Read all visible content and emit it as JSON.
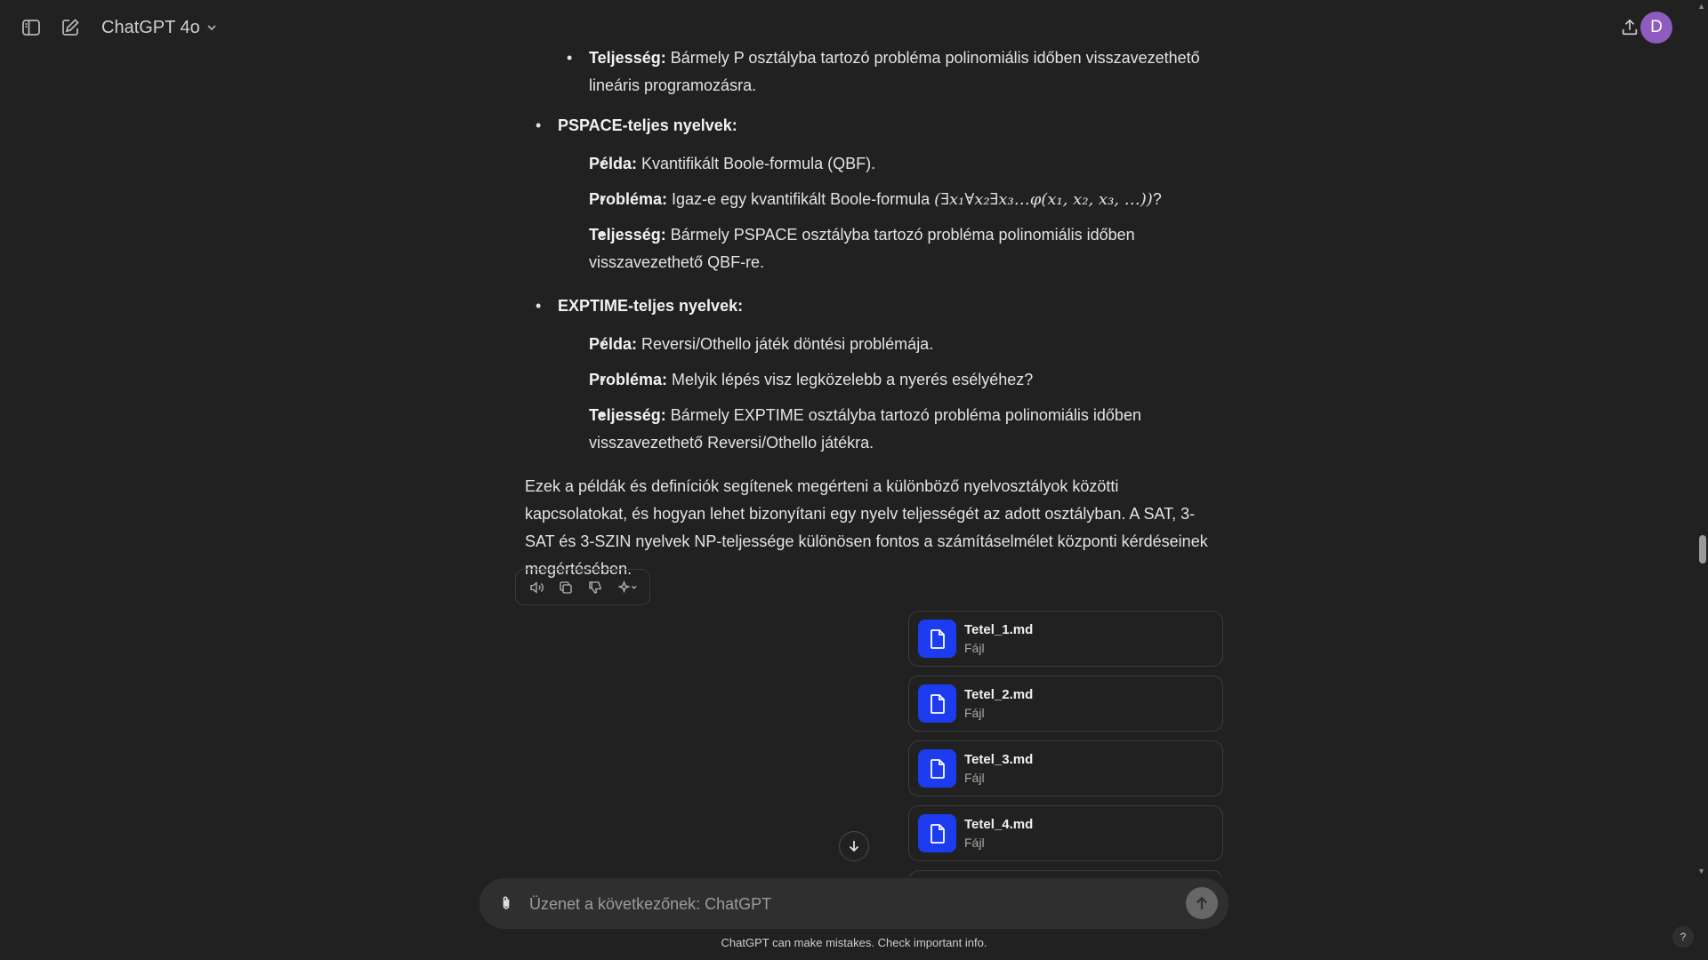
{
  "header": {
    "model_label": "ChatGPT 4o",
    "avatar_initial": "D",
    "icons": [
      "sidebar-toggle-icon",
      "new-chat-icon",
      "chevron-down-icon",
      "share-icon"
    ]
  },
  "message": {
    "top_item_bold": "Teljesség:",
    "top_item_text": " Bármely P osztályba tartozó probléma polinomiális időben visszavezethető lineáris programozásra.",
    "sections": [
      {
        "title": "PSPACE-teljes nyelvek:",
        "items": [
          {
            "bold": "Példa:",
            "text": " Kvantifikált Boole-formula (QBF)."
          },
          {
            "bold": "Probléma:",
            "text": " Igaz-e egy kvantifikált Boole-formula ",
            "math": "(∃x₁∀x₂∃x₃…φ(x₁, x₂, x₃, …))",
            "after": "?"
          },
          {
            "bold": "Teljesség:",
            "text": " Bármely PSPACE osztályba tartozó probléma polinomiális időben visszavezethető QBF-re."
          }
        ]
      },
      {
        "title": "EXPTIME-teljes nyelvek:",
        "items": [
          {
            "bold": "Példa:",
            "text": " Reversi/Othello játék döntési problémája."
          },
          {
            "bold": "Probléma:",
            "text": " Melyik lépés visz legközelebb a nyerés esélyéhez?"
          },
          {
            "bold": "Teljesség:",
            "text": " Bármely EXPTIME osztályba tartozó probléma polinomiális időben visszavezethető Reversi/Othello játékra."
          }
        ]
      }
    ],
    "closing_paragraph": "Ezek a példák és definíciók segítenek megérteni a különböző nyelvosztályok közötti kapcsolatokat, és hogyan lehet bizonyítani egy nyelv teljességét az adott osztályban. A SAT, 3-SAT és 3-SZIN nyelvek NP-teljessége különösen fontos a számításelmélet központi kérdéseinek megértésében."
  },
  "actions": [
    "read-aloud-icon",
    "copy-icon",
    "thumbs-down-icon",
    "regenerate-icon"
  ],
  "files": [
    {
      "name": "Tetel_1.md",
      "type": "Fájl"
    },
    {
      "name": "Tetel_2.md",
      "type": "Fájl"
    },
    {
      "name": "Tetel_3.md",
      "type": "Fájl"
    },
    {
      "name": "Tetel_4.md",
      "type": "Fájl"
    }
  ],
  "composer": {
    "placeholder": "Üzenet a következőnek: ChatGPT"
  },
  "footer": {
    "disclaimer": "ChatGPT can make mistakes. Check important info.",
    "help_label": "?"
  }
}
